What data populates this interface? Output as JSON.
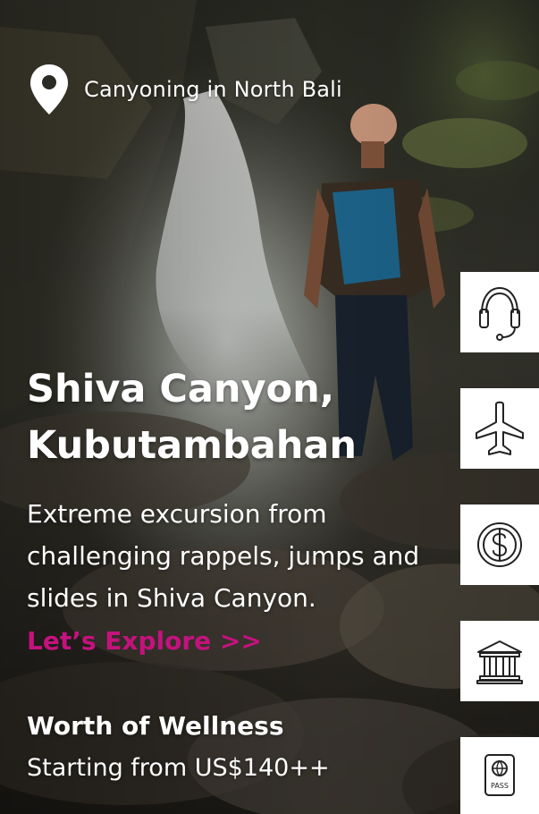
{
  "location": {
    "icon": "map-pin-icon",
    "text": "Canyoning in North Bali"
  },
  "hero": {
    "title": "Shiva Canyon, Kubutambahan",
    "description": "Extreme excursion from challenging rappels, jumps and slides in Shiva Canyon.",
    "cta_label": "Let’s Explore >>",
    "worth_label": "Worth of Wellness",
    "price_label": "Starting from US$140++"
  },
  "side_actions": [
    {
      "icon": "headset-icon"
    },
    {
      "icon": "airplane-icon"
    },
    {
      "icon": "dollar-coin-icon"
    },
    {
      "icon": "bank-icon"
    },
    {
      "icon": "passport-icon"
    }
  ],
  "colors": {
    "accent": "#c4127d",
    "text": "#ffffff",
    "side_button_bg": "#ffffff",
    "icon_stroke": "#222222"
  }
}
